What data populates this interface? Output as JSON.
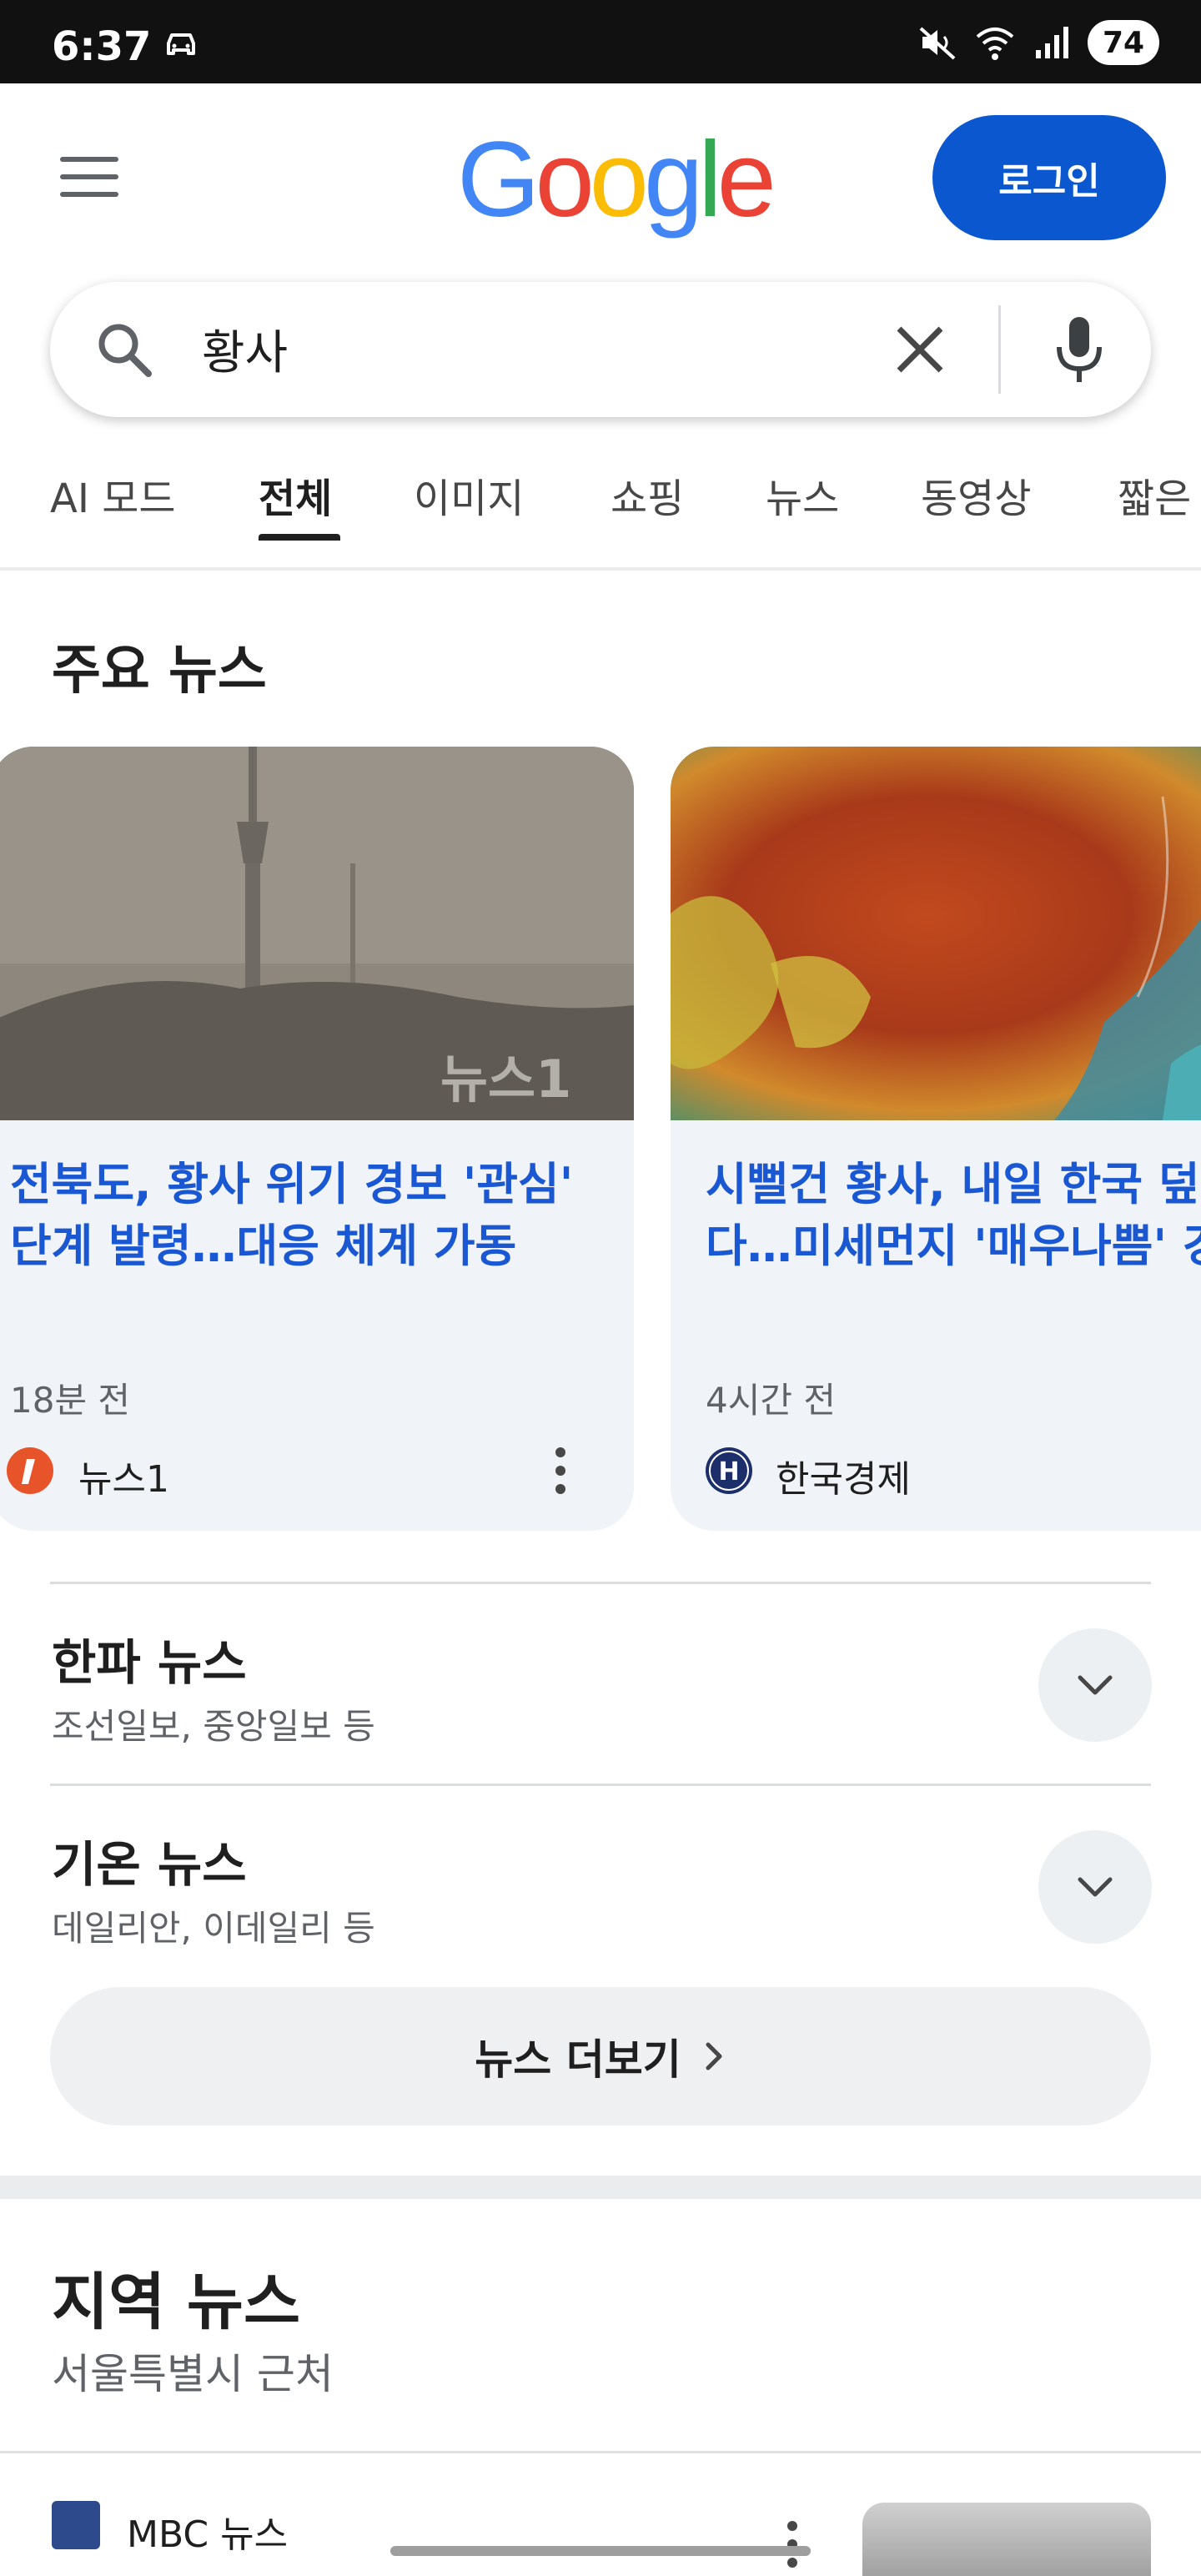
{
  "status_bar": {
    "time": "6:37",
    "battery": "74"
  },
  "header": {
    "logo_letters": [
      "G",
      "o",
      "o",
      "g",
      "l",
      "e"
    ],
    "login_label": "로그인"
  },
  "search": {
    "query": "황사"
  },
  "tabs": [
    "AI 모드",
    "전체",
    "이미지",
    "쇼핑",
    "뉴스",
    "동영상",
    "짧은"
  ],
  "active_tab": "전체",
  "top_stories": {
    "title": "주요 뉴스",
    "cards": [
      {
        "headline": "전북도, 황사 위기 경보 '관심' 단계 발령…대응 체계 가동",
        "time": "18분 전",
        "source": "뉴스1",
        "image_watermark": "뉴스1"
      },
      {
        "headline": "시뻘건 황사, 내일 한국 덮친다…미세먼지 '매우나쁨' 경고",
        "time": "4시간 전",
        "source": "한국경제"
      }
    ]
  },
  "expanders": [
    {
      "title": "한파 뉴스",
      "sub": "조선일보, 중앙일보 등"
    },
    {
      "title": "기온 뉴스",
      "sub": "데일리안, 이데일리 등"
    }
  ],
  "more_news_label": "뉴스 더보기",
  "local_news": {
    "title": "지역 뉴스",
    "subtitle": "서울특별시 근처",
    "first_source": "MBC 뉴스"
  },
  "colors": {
    "accent": "#0b57d0",
    "link": "#1a57d2",
    "google_blue": "#4285f4",
    "google_red": "#ea4335",
    "google_yellow": "#fbbc05",
    "google_green": "#34a853"
  }
}
